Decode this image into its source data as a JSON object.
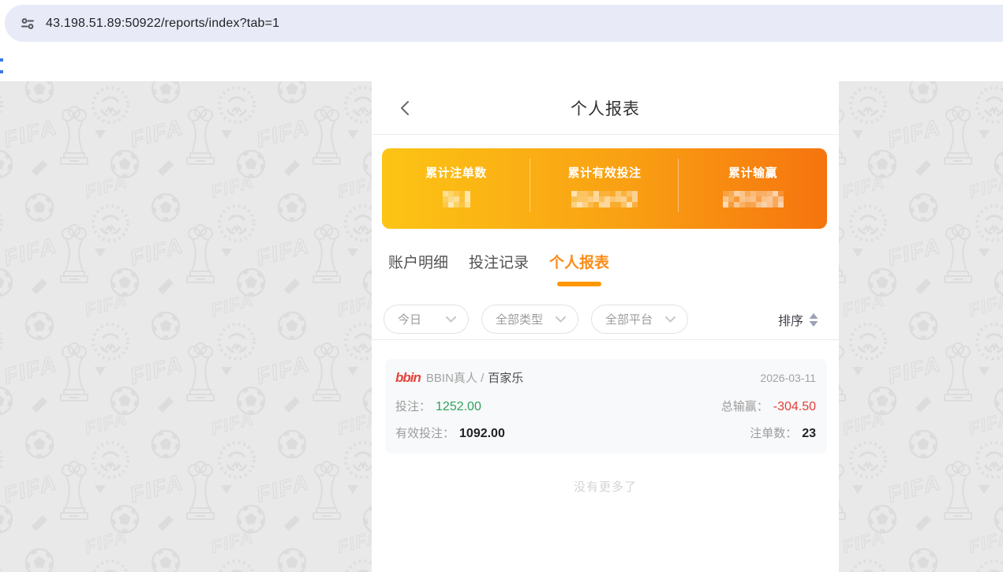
{
  "browser": {
    "url": "43.198.51.89:50922/reports/index?tab=1"
  },
  "page": {
    "header": {
      "title": "个人报表"
    },
    "stats": {
      "items": [
        {
          "label": "累计注单数",
          "value": "censored"
        },
        {
          "label": "累计有效投注",
          "value": "censored"
        },
        {
          "label": "累计输赢",
          "value": "censored"
        }
      ]
    },
    "tabs": [
      {
        "label": "账户明细",
        "active": false
      },
      {
        "label": "投注记录",
        "active": false
      },
      {
        "label": "个人报表",
        "active": true
      }
    ],
    "filters": {
      "dropdowns": [
        {
          "label": "今日"
        },
        {
          "label": "全部类型"
        },
        {
          "label": "全部平台"
        }
      ],
      "sort_label": "排序"
    },
    "records": [
      {
        "logo": "bbin",
        "provider": "BBIN真人 /",
        "game": "百家乐",
        "date": "2026-03-11",
        "bet_label": "投注：",
        "bet": "1252.00",
        "winloss_label": "总输赢：",
        "winloss": "-304.50",
        "valid_bet_label": "有效投注：",
        "valid_bet": "1092.00",
        "count_label": "注单数：",
        "count": "23"
      }
    ],
    "no_more": "没有更多了"
  },
  "colors": {
    "accent_orange": "#fa8c16",
    "tab_underline": "#ff9800",
    "card_gradient_start": "#fcc415",
    "card_gradient_end": "#f6740e",
    "positive_green": "#2fa25c",
    "negative_red": "#e23d38",
    "url_bar_bg": "#e8eaf7",
    "watermark_bg": "#e9e9e9"
  }
}
